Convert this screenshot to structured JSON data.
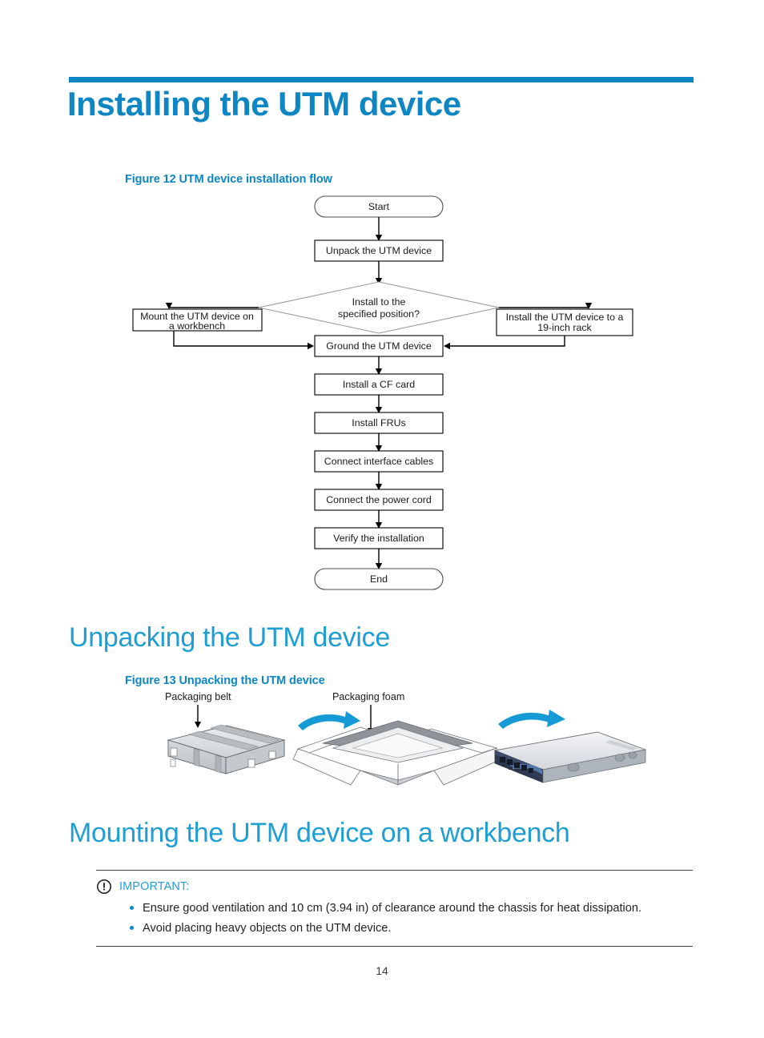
{
  "page": {
    "title": "Installing the UTM device",
    "number": "14",
    "accent_color": "#0e86c3",
    "heading_color": "#1f9ed4",
    "rule_color": "#0b85c4"
  },
  "figure12": {
    "caption": "Figure 12 UTM device installation flow",
    "nodes": {
      "start": "Start",
      "unpack": "Unpack the UTM device",
      "decision_line1": "Install to the",
      "decision_line2": "specified position?",
      "workbench_line1": "Mount the UTM device on",
      "workbench_line2": "a workbench",
      "rack_line1": "Install the UTM device to a",
      "rack_line2": "19-inch rack",
      "ground": "Ground the UTM device",
      "cf_card": "Install a CF card",
      "frus": "Install FRUs",
      "interface_cables": "Connect interface cables",
      "power_cord": "Connect the power cord",
      "verify": "Verify the installation",
      "end": "End"
    }
  },
  "section_unpacking": {
    "heading": "Unpacking the UTM device"
  },
  "figure13": {
    "caption": "Figure 13 Unpacking the UTM device",
    "labels": {
      "belt": "Packaging belt",
      "foam": "Packaging foam"
    }
  },
  "section_mounting": {
    "heading": "Mounting the UTM device on a workbench"
  },
  "important": {
    "label": "IMPORTANT:",
    "icon": "exclamation-circle-icon",
    "items": [
      "Ensure good ventilation and 10 cm (3.94 in) of clearance around the chassis for heat dissipation.",
      "Avoid placing heavy objects on the UTM device."
    ]
  }
}
